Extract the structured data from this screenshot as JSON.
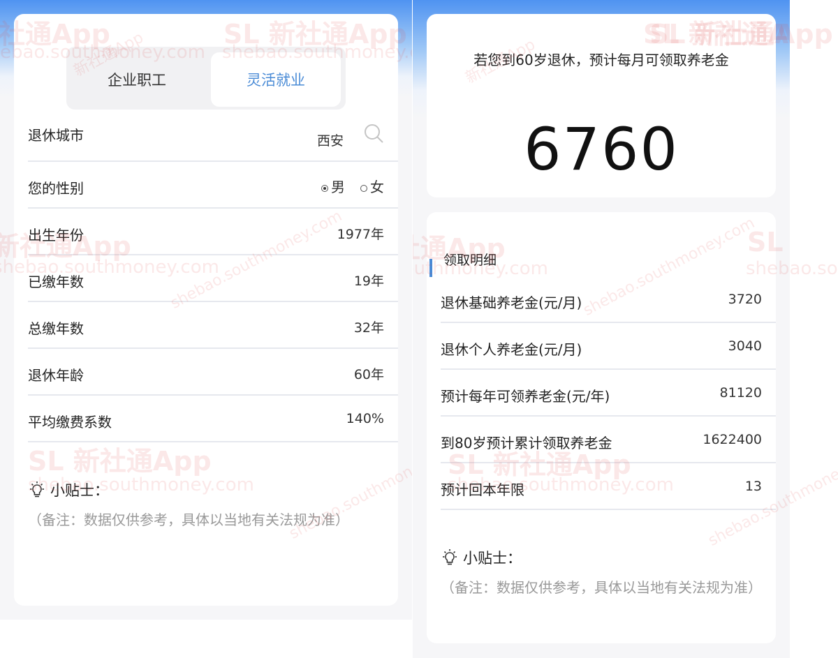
{
  "watermark": {
    "brand": "新社通App",
    "domain": "shebao.southmoney.com",
    "logo_text": "SL"
  },
  "left": {
    "tabs": [
      {
        "label": "企业职工",
        "active": false
      },
      {
        "label": "灵活就业",
        "active": true
      }
    ],
    "form": {
      "city": {
        "label": "退休城市",
        "value": "西安",
        "icon": "search-icon"
      },
      "gender": {
        "label": "您的性别",
        "options": [
          {
            "label": "男",
            "checked": true
          },
          {
            "label": "女",
            "checked": false
          }
        ]
      },
      "birth_year": {
        "label": "出生年份",
        "value": "1977年"
      },
      "paid_years": {
        "label": "已缴年数",
        "value": "19年"
      },
      "total_years": {
        "label": "总缴年数",
        "value": "32年"
      },
      "retire_age": {
        "label": "退休年龄",
        "value": "60年"
      },
      "avg_coefficient": {
        "label": "平均缴费系数",
        "value": "140%"
      }
    },
    "tips": {
      "title": "小贴士：",
      "icon": "lightbulb-icon",
      "note": "（备注：数据仅供参考，具体以当地有关法规为准）"
    }
  },
  "right": {
    "hint": "若您到60岁退休，预计每月可领取养老金",
    "monthly_pension": "6760",
    "detail_title": "领取明细",
    "details": [
      {
        "label": "退休基础养老金(元/月)",
        "value": "3720"
      },
      {
        "label": "退休个人养老金(元/月)",
        "value": "3040"
      },
      {
        "label": "预计每年可领养老金(元/年)",
        "value": "81120"
      },
      {
        "label": "到80岁预计累计领取养老金",
        "value": "1622400"
      },
      {
        "label": "预计回本年限",
        "value": "13"
      }
    ],
    "tips": {
      "title": "小贴士：",
      "icon": "lightbulb-icon",
      "note": "（备注：数据仅供参考，具体以当地有关法规为准）"
    }
  },
  "colors": {
    "accent": "#4a8bd6",
    "header_gradient_top": "#4f93f1",
    "background": "#f6f6f8",
    "watermark": "#e15050"
  }
}
